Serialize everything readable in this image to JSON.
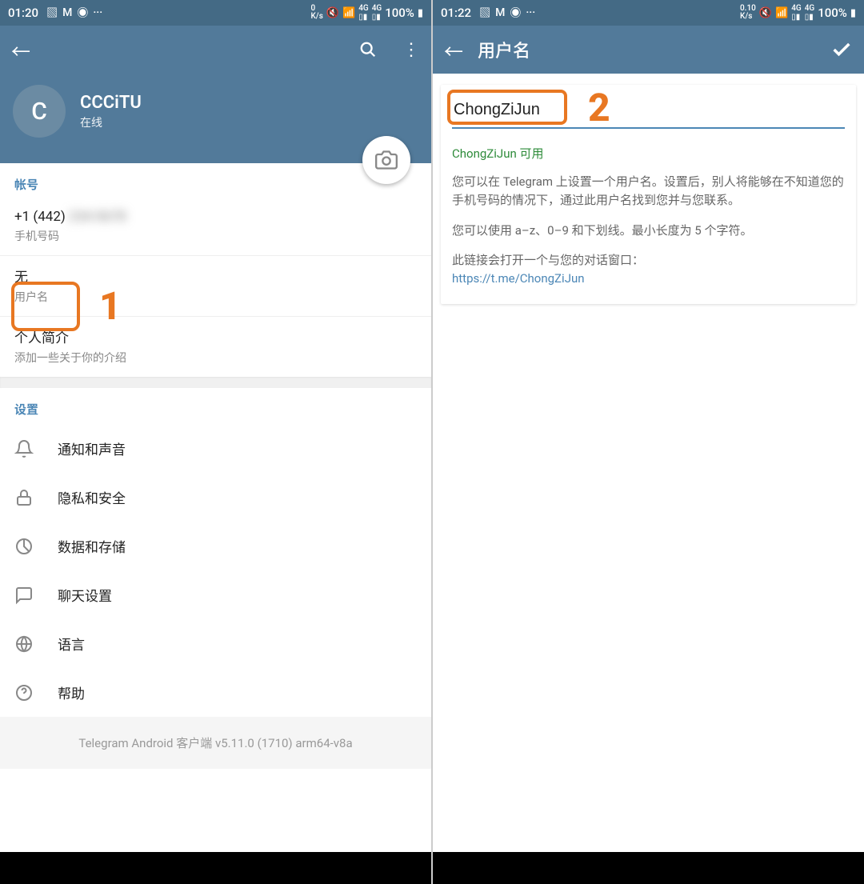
{
  "left": {
    "statusbar": {
      "time": "01:20",
      "speed": "0\nK/s",
      "battery_pct": "100%"
    },
    "profile": {
      "avatar_letter": "C",
      "name": "CCCiTU",
      "status": "在线"
    },
    "account": {
      "section_title": "帐号",
      "phone": "+1 (442)",
      "phone_blur": "234-5678",
      "phone_label": "手机号码",
      "username_value": "无",
      "username_label": "用户名",
      "bio_title": "个人简介",
      "bio_sub": "添加一些关于你的介绍"
    },
    "settings": {
      "section_title": "设置",
      "items": [
        {
          "label": "通知和声音"
        },
        {
          "label": "隐私和安全"
        },
        {
          "label": "数据和存储"
        },
        {
          "label": "聊天设置"
        },
        {
          "label": "语言"
        },
        {
          "label": "帮助"
        }
      ]
    },
    "version": "Telegram Android 客户端 v5.11.0 (1710) arm64-v8a",
    "annotation_1": "1"
  },
  "right": {
    "statusbar": {
      "time": "01:22",
      "speed": "0.10\nK/s",
      "battery_pct": "100%"
    },
    "appbar_title": "用户名",
    "username_input": "ChongZiJun",
    "available_text": "ChongZiJun 可用",
    "desc1": "您可以在 Telegram 上设置一个用户名。设置后，别人将能够在不知道您的手机号码的情况下，通过此用户名找到您并与您联系。",
    "desc2": "您可以使用 a–z、0–9 和下划线。最小长度为 5 个字符。",
    "desc3": "此链接会打开一个与您的对话窗口：",
    "link": "https://t.me/ChongZiJun",
    "annotation_2": "2"
  }
}
